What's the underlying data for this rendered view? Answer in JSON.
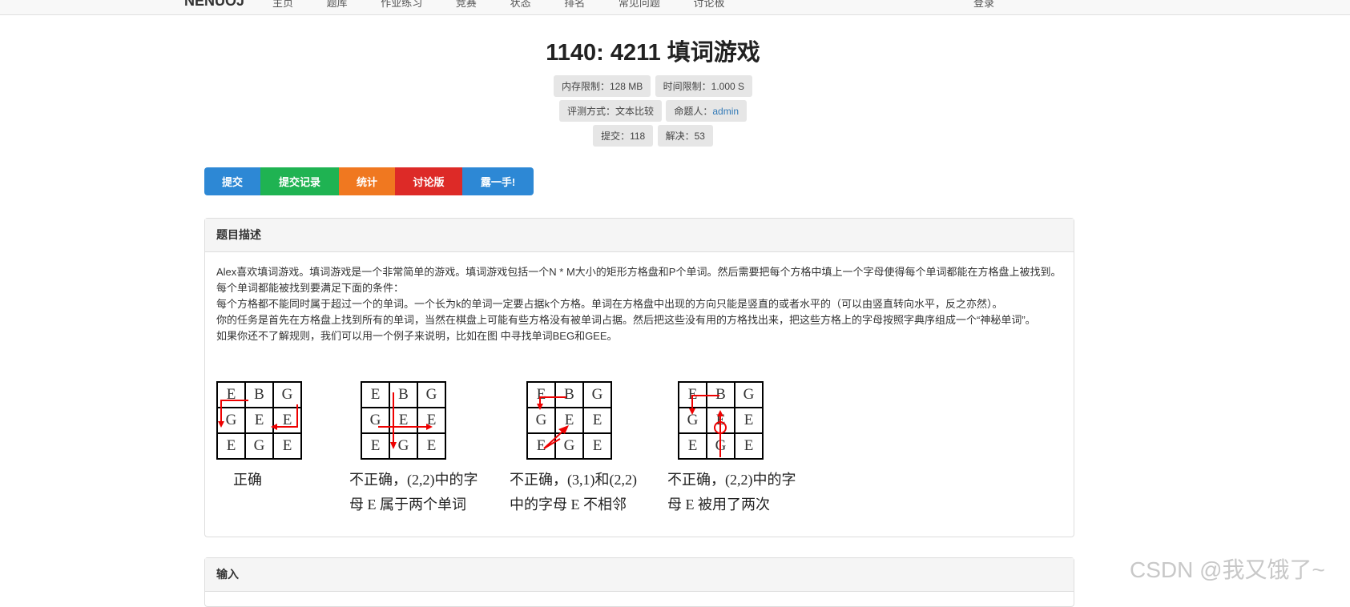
{
  "topbar": {
    "brand": "NENUOJ",
    "nav": [
      "主页",
      "题库",
      "作业练习",
      "竞赛",
      "状态",
      "排名",
      "常见问题",
      "讨论板"
    ],
    "right": "登录"
  },
  "problem": {
    "title": "1140: 4211 填词游戏",
    "memory_label": "内存限制：",
    "memory_value": "128 MB",
    "time_label": "时间限制：",
    "time_value": "1.000 S",
    "judge_label": "评测方式：",
    "judge_value": "文本比较",
    "author_label": "命题人：",
    "author_value": "admin",
    "submit_label": "提交：",
    "submit_value": "118",
    "solved_label": "解决：",
    "solved_value": "53"
  },
  "buttons": [
    {
      "label": "提交",
      "color": "#2d88d5"
    },
    {
      "label": "提交记录",
      "color": "#1fb352"
    },
    {
      "label": "统计",
      "color": "#f07820"
    },
    {
      "label": "讨论版",
      "color": "#dd2a27"
    },
    {
      "label": "露一手!",
      "color": "#2d88d5"
    }
  ],
  "description": {
    "header": "题目描述",
    "lines": [
      "Alex喜欢填词游戏。填词游戏是一个非常简单的游戏。填词游戏包括一个N * M大小的矩形方格盘和P个单词。然后需要把每个方格中填上一个字母使得每个单词都能在方格盘上被找到。每个单词都能被找到要满足下面的条件：",
      "每个方格都不能同时属于超过一个的单词。一个长为k的单词一定要占据k个方格。单词在方格盘中出现的方向只能是竖直的或者水平的（可以由竖直转向水平，反之亦然）。",
      "你的任务是首先在方格盘上找到所有的单词，当然在棋盘上可能有些方格没有被单词占据。然后把这些没有用的方格找出来，把这些方格上的字母按照字典序组成一个“神秘单词”。",
      "如果你还不了解规则，我们可以用一个例子来说明，比如在图 中寻找单词BEG和GEE。"
    ]
  },
  "examples": [
    {
      "grid": [
        [
          "E",
          "B",
          "G"
        ],
        [
          "G",
          "E",
          "E"
        ],
        [
          "E",
          "G",
          "E"
        ]
      ],
      "caption1": "正确",
      "caption2": ""
    },
    {
      "grid": [
        [
          "E",
          "B",
          "G"
        ],
        [
          "G",
          "E",
          "E"
        ],
        [
          "E",
          "G",
          "E"
        ]
      ],
      "caption1": "不正确，(2,2)中的字",
      "caption2": "母 E 属于两个单词"
    },
    {
      "grid": [
        [
          "E",
          "B",
          "G"
        ],
        [
          "G",
          "E",
          "E"
        ],
        [
          "E",
          "G",
          "E"
        ]
      ],
      "caption1": "不正确，(3,1)和(2,2)",
      "caption2": "中的字母 E 不相邻"
    },
    {
      "grid": [
        [
          "E",
          "B",
          "G"
        ],
        [
          "G",
          "E",
          "E"
        ],
        [
          "E",
          "G",
          "E"
        ]
      ],
      "caption1": "不正确，(2,2)中的字",
      "caption2": "母 E 被用了两次"
    }
  ],
  "input": {
    "header": "输入"
  },
  "watermark": "CSDN @我又饿了~"
}
